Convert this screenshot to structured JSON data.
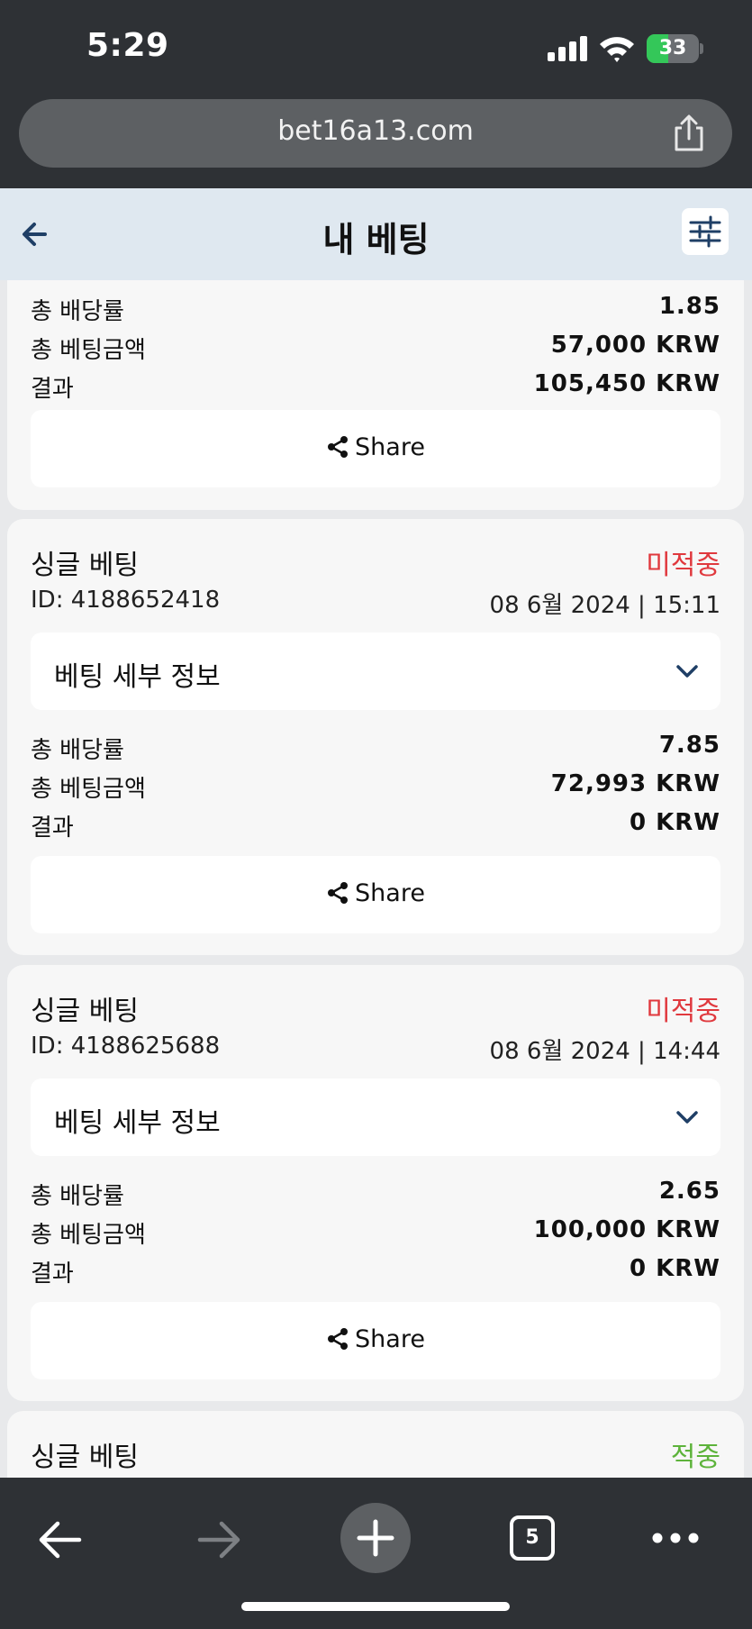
{
  "status_bar": {
    "time": "5:29",
    "battery": "33",
    "battery_level": 0.33
  },
  "browser": {
    "url": "bet16a13.com",
    "tab_count": "5"
  },
  "header": {
    "title": "내 베팅"
  },
  "cards": [
    {
      "odds_label": "총 배당률",
      "odds": "1.85",
      "stake_label": "총 베팅금액",
      "stake": "57,000 KRW",
      "result_label": "결과",
      "result": "105,450 KRW",
      "share_label": "Share"
    },
    {
      "type": "싱글 베팅",
      "status": "미적중",
      "status_color": "#e0393e",
      "id": "ID: 4188652418",
      "date": "08 6월 2024 | 15:11",
      "details_label": "베팅 세부 정보",
      "odds_label": "총 배당률",
      "odds": "7.85",
      "stake_label": "총 베팅금액",
      "stake": "72,993 KRW",
      "result_label": "결과",
      "result": "0 KRW",
      "share_label": "Share"
    },
    {
      "type": "싱글 베팅",
      "status": "미적중",
      "status_color": "#e0393e",
      "id": "ID: 4188625688",
      "date": "08 6월 2024 | 14:44",
      "details_label": "베팅 세부 정보",
      "odds_label": "총 배당률",
      "odds": "2.65",
      "stake_label": "총 베팅금액",
      "stake": "100,000 KRW",
      "result_label": "결과",
      "result": "0 KRW",
      "share_label": "Share"
    },
    {
      "type": "싱글 베팅",
      "status": "적중",
      "status_color": "#5db33b"
    }
  ],
  "icons": {
    "back": "arrow-left-icon",
    "filter": "sliders-icon",
    "share": "share-nodes-icon",
    "chevron": "chevron-down-icon",
    "browser_share": "share-box-icon"
  },
  "colors": {
    "accent": "#1f3f66",
    "lost": "#e0393e",
    "won": "#5db33b"
  }
}
